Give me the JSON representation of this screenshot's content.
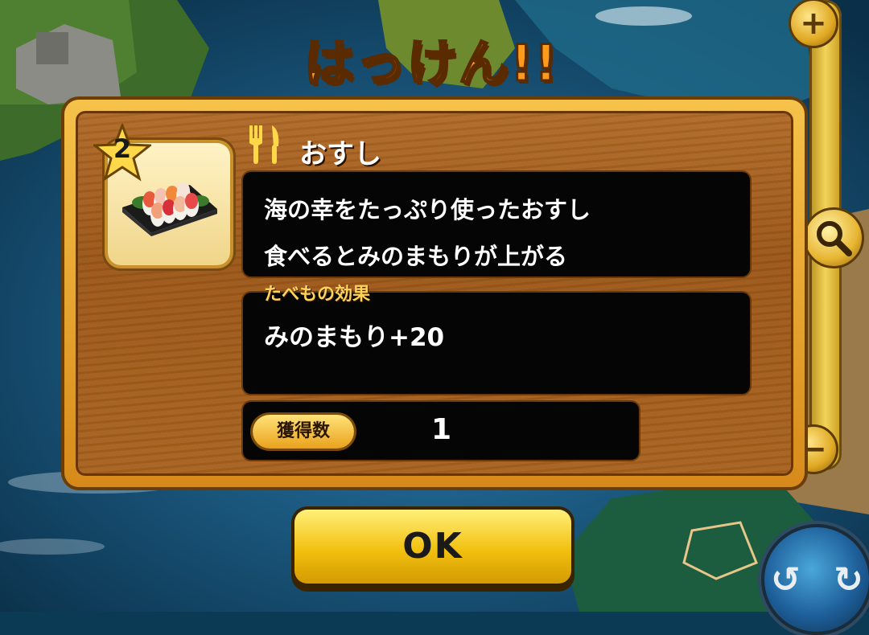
{
  "dialog": {
    "title": "はっけん!!",
    "item": {
      "rarity": "2",
      "category_icon": "fork-knife-icon",
      "name": "おすし",
      "description_lines": [
        "海の幸をたっぷり使ったおすし",
        "食べるとみのまもりが上がる"
      ],
      "effect_label": "たべもの効果",
      "effect_value": "みのまもり+20",
      "count_label": "獲得数",
      "count_value": "1"
    },
    "ok_label": "OK"
  },
  "map_controls": {
    "zoom_in": "+",
    "zoom_out": "−",
    "zoom_knob_icon": "magnifier-icon",
    "globe_icon": "globe-rotate-icon",
    "globe_left_arrow": "↺",
    "globe_right_arrow": "↻"
  },
  "colors": {
    "panel_border": "#f6c24a",
    "panel_wood": "#a8621f",
    "title_orange": "#ff9a1a",
    "ok_yellow": "#f2c010",
    "effect_label": "#ffd35a"
  }
}
